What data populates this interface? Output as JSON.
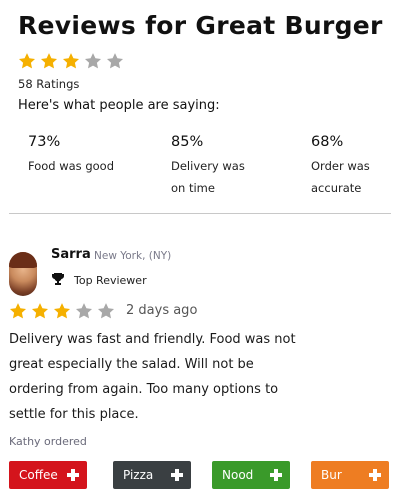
{
  "header": {
    "title": "Reviews for Great Burger",
    "rating_stars": 3,
    "rating_max": 5,
    "ratings_count": "58 Ratings",
    "saying_label": "Here's what people are saying:"
  },
  "stats": [
    {
      "pct": "73%",
      "label": "Food was good"
    },
    {
      "pct": "85%",
      "label": "Delivery was on time"
    },
    {
      "pct": "68%",
      "label": "Order was accurate"
    }
  ],
  "review": {
    "name": "Sarra",
    "location": "New York, (NY)",
    "badge": "Top Reviewer",
    "stars": 3,
    "date": "2 days ago",
    "text": "Delivery was fast and friendly. Food was not great especially the salad. Will not be ordering from again. Too many options to settle for this place.",
    "ordered_label": "Kathy ordered",
    "tags": [
      {
        "label": "Coffee",
        "color": "#d4141c"
      },
      {
        "label": "Pizza",
        "color": "#3a3f42"
      },
      {
        "label": "Nood",
        "color": "#3a9a2a"
      },
      {
        "label": "Bur",
        "color": "#ee7d22"
      }
    ]
  },
  "colors": {
    "star_on": "#f5b000",
    "star_off": "#a8a8a8"
  },
  "icons": [
    "star-icon",
    "trophy-icon",
    "plus-icon",
    "avatar"
  ]
}
